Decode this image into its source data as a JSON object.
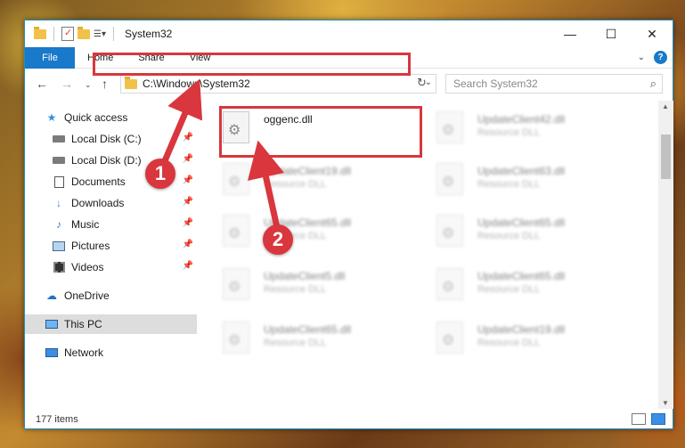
{
  "window": {
    "title": "System32",
    "controls": [
      "—",
      "☐",
      "✕"
    ]
  },
  "ribbon": {
    "tabs": [
      "File",
      "Home",
      "Share",
      "View"
    ]
  },
  "navigation": {
    "address": "C:\\Windows\\System32",
    "search_placeholder": "Search System32"
  },
  "sidebar": {
    "items": [
      {
        "label": "Quick access",
        "icon": "star-icon"
      },
      {
        "label": "Local Disk (C:)",
        "icon": "drive-icon",
        "pinned": true
      },
      {
        "label": "Local Disk (D:)",
        "icon": "drive-icon",
        "pinned": true
      },
      {
        "label": "Documents",
        "icon": "documents-icon",
        "pinned": true
      },
      {
        "label": "Downloads",
        "icon": "downloads-icon",
        "pinned": true
      },
      {
        "label": "Music",
        "icon": "music-icon",
        "pinned": true
      },
      {
        "label": "Pictures",
        "icon": "pictures-icon",
        "pinned": true
      },
      {
        "label": "Videos",
        "icon": "videos-icon",
        "pinned": true
      },
      {
        "label": "OneDrive",
        "icon": "onedrive-icon"
      },
      {
        "label": "This PC",
        "icon": "this-pc-icon",
        "selected": true
      },
      {
        "label": "Network",
        "icon": "network-icon"
      }
    ]
  },
  "files": [
    {
      "name": "oggenc.dll",
      "type": ""
    },
    {
      "name": "UpdateClient42.dll",
      "type": "Resource DLL"
    },
    {
      "name": "UpdateClient19.dll",
      "type": "Resource DLL"
    },
    {
      "name": "UpdateClient63.dll",
      "type": "Resource DLL"
    },
    {
      "name": "UpdateClient65.dll",
      "type": "Resource DLL"
    },
    {
      "name": "UpdateClient65.dll",
      "type": "Resource DLL"
    },
    {
      "name": "UpdateClient5.dll",
      "type": "Resource DLL"
    },
    {
      "name": "UpdateClient65.dll",
      "type": "Resource DLL"
    },
    {
      "name": "UpdateClient65.dll",
      "type": "Resource DLL"
    },
    {
      "name": "UpdateClient19.dll",
      "type": "Resource DLL"
    }
  ],
  "status": {
    "item_count": "177 items"
  },
  "annotations": {
    "step1": "1",
    "step2": "2",
    "color": "#d9363e"
  }
}
